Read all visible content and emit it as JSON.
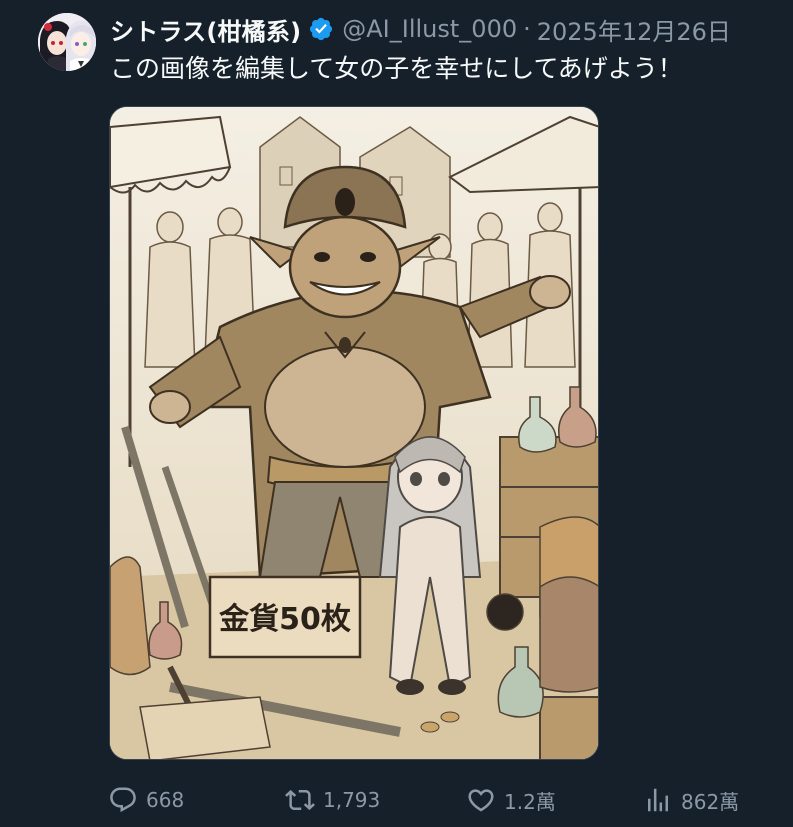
{
  "tweet": {
    "author": {
      "display_name": "シトラス(柑橘系)",
      "handle": "@AI_Illust_000",
      "verified": true,
      "avatar_icon": "avatar-image"
    },
    "separator": "·",
    "date": "2025年12月26日",
    "text": "この画像を編集して女の子を幸せにしてあげよう！",
    "media": {
      "sign_text": "金貨50枚"
    },
    "actions": {
      "replies": "668",
      "retweets": "1,793",
      "likes": "1.2萬",
      "views": "862萬"
    }
  },
  "colors": {
    "background": "#15202b",
    "text_primary": "#f7f9f9",
    "text_secondary": "#8b98a5",
    "verified_blue": "#1d9bf0"
  },
  "icons": [
    "reply-icon",
    "retweet-icon",
    "like-icon",
    "views-icon",
    "verified-badge-icon"
  ]
}
